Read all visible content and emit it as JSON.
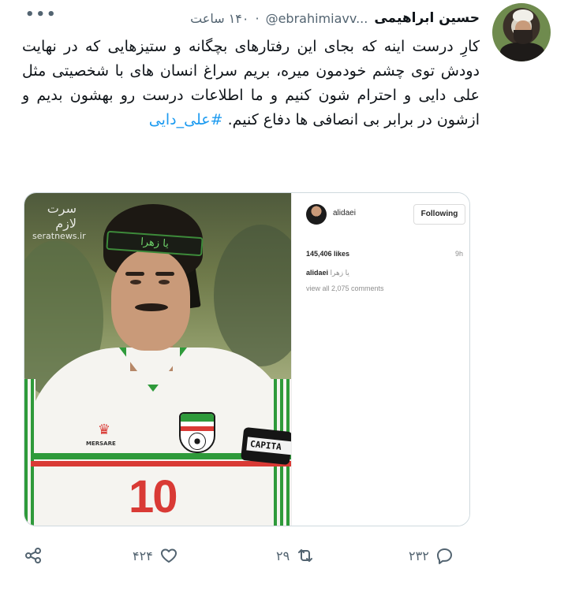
{
  "tweet": {
    "display_name": "حسین ابراهیمی",
    "handle": "@ebrahimiavv...",
    "time": "۱۴۰ ساعت",
    "more_icon": "more-horizontal-icon",
    "text": "کارِ درست اینه که بجای این رفتارهای بچگانه و ستیزهایی که در نهایت دودش توی چشم خودمون میره، بریم سراغ انسان های با شخصیتی مثل علی دایی و احترام شون کنیم و ما اطلاعات درست رو بهشون بدیم و ازشون در برابر بی انصافی ها دفاع کنیم.",
    "hashtag": "#علی_دایی"
  },
  "media": {
    "watermark_mark": "سرت لازم",
    "watermark_site": "seratnews.ir",
    "headband_text": "یا زهرا",
    "jersey_brand": "MERSARE",
    "jersey_number": "10",
    "captain_text": "CAPITA",
    "instagram": {
      "username": "alidaei",
      "follow_label": "Following",
      "likes": "145,406 likes",
      "time": "9h",
      "caption_user": "alidaei",
      "caption_text": "یا زهرا",
      "comments": "view all 2,075 comments"
    }
  },
  "actions": {
    "reply_count": "۲۳۲",
    "retweet_count": "۲۹",
    "like_count": "۴۲۴",
    "reply_icon": "reply-icon",
    "retweet_icon": "retweet-icon",
    "like_icon": "heart-icon",
    "share_icon": "share-icon"
  }
}
